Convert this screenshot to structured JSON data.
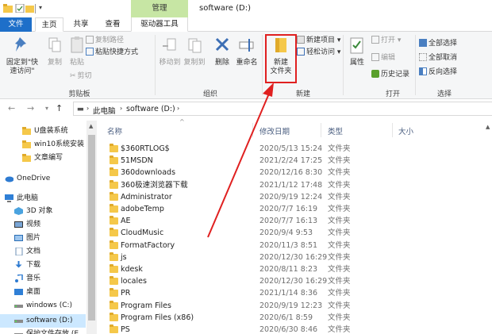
{
  "window": {
    "title": "software (D:)",
    "contextual_tab_group": "管理"
  },
  "tabs": {
    "file": "文件",
    "home": "主页",
    "share": "共享",
    "view": "查看",
    "drive_tools": "驱动器工具"
  },
  "ribbon": {
    "clipboard": {
      "group_label": "剪贴板",
      "pin": "固定到\"快\n速访问\"",
      "copy": "复制",
      "paste": "粘贴",
      "copy_path": "复制路径",
      "paste_shortcut": "粘贴快捷方式",
      "cut": "剪切"
    },
    "organize": {
      "group_label": "组织",
      "move_to": "移动到",
      "copy_to": "复制到",
      "delete": "删除",
      "rename": "重命名"
    },
    "new": {
      "group_label": "新建",
      "new_folder": "新建\n文件夹",
      "new_item": "新建项目",
      "easy_access": "轻松访问"
    },
    "open": {
      "group_label": "打开",
      "properties": "属性",
      "open": "打开",
      "edit": "编辑",
      "history": "历史记录"
    },
    "select": {
      "group_label": "选择",
      "select_all": "全部选择",
      "select_none": "全部取消",
      "invert": "反向选择"
    }
  },
  "address": {
    "crumbs": [
      "此电脑",
      "software (D:)"
    ]
  },
  "columns": {
    "name": "名称",
    "date": "修改日期",
    "type": "类型",
    "size": "大小"
  },
  "nav": [
    {
      "label": "U盘装系统",
      "icon": "folder-icon"
    },
    {
      "label": "win10系统安装",
      "icon": "folder-icon"
    },
    {
      "label": "文章编写",
      "icon": "folder-icon"
    },
    {
      "label": "OneDrive",
      "icon": "cloud-icon"
    },
    {
      "label": "此电脑",
      "icon": "computer-icon"
    },
    {
      "label": "3D 对象",
      "icon": "cube-icon"
    },
    {
      "label": "视频",
      "icon": "video-icon"
    },
    {
      "label": "图片",
      "icon": "picture-icon"
    },
    {
      "label": "文档",
      "icon": "document-icon"
    },
    {
      "label": "下载",
      "icon": "download-icon"
    },
    {
      "label": "音乐",
      "icon": "music-icon"
    },
    {
      "label": "桌面",
      "icon": "desktop-icon"
    },
    {
      "label": "windows (C:)",
      "icon": "drive-icon"
    },
    {
      "label": "software (D:)",
      "icon": "drive-icon",
      "selected": true
    },
    {
      "label": "保护文件存放 (E",
      "icon": "drive-icon"
    }
  ],
  "files": [
    {
      "name": "$360RTLOG$",
      "date": "2020/5/13 15:24",
      "type": "文件夹"
    },
    {
      "name": "51MSDN",
      "date": "2021/2/24 17:25",
      "type": "文件夹"
    },
    {
      "name": "360downloads",
      "date": "2020/12/16 8:30",
      "type": "文件夹"
    },
    {
      "name": "360极速浏览器下载",
      "date": "2021/1/12 17:48",
      "type": "文件夹"
    },
    {
      "name": "Administrator",
      "date": "2020/9/19 12:24",
      "type": "文件夹"
    },
    {
      "name": "adobeTemp",
      "date": "2020/7/7 16:19",
      "type": "文件夹"
    },
    {
      "name": "AE",
      "date": "2020/7/7 16:13",
      "type": "文件夹"
    },
    {
      "name": "CloudMusic",
      "date": "2020/9/4 9:53",
      "type": "文件夹"
    },
    {
      "name": "FormatFactory",
      "date": "2020/11/3 8:51",
      "type": "文件夹"
    },
    {
      "name": "js",
      "date": "2020/12/30 16:29",
      "type": "文件夹"
    },
    {
      "name": "kdesk",
      "date": "2020/8/11 8:23",
      "type": "文件夹"
    },
    {
      "name": "locales",
      "date": "2020/12/30 16:29",
      "type": "文件夹"
    },
    {
      "name": "PR",
      "date": "2021/1/14 8:36",
      "type": "文件夹"
    },
    {
      "name": "Program Files",
      "date": "2020/9/19 12:23",
      "type": "文件夹"
    },
    {
      "name": "Program Files (x86)",
      "date": "2020/6/1 8:59",
      "type": "文件夹"
    },
    {
      "name": "PS",
      "date": "2020/6/30 8:46",
      "type": "文件夹"
    }
  ],
  "colors": {
    "file_tab": "#1e6fc9",
    "management_tab": "#c7e6a4",
    "folder": "#f5c84a",
    "selected": "#cce8ff",
    "highlight_box": "#e02020",
    "column_header": "#4d6082"
  }
}
